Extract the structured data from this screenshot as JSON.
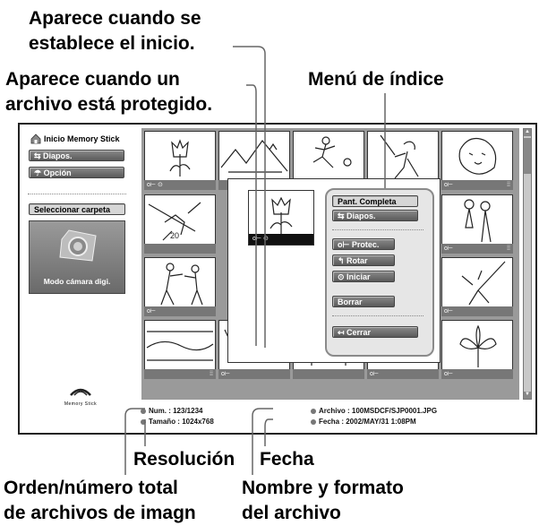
{
  "callouts": {
    "start_set": "Aparece cuando se",
    "start_set_2": "establece el inicio.",
    "protected": "Aparece cuando un",
    "protected_2": "archivo está protegido.",
    "index_menu": "Menú de índice",
    "resolution": "Resolución",
    "date": "Fecha",
    "order": "Orden/número total",
    "order_2": "de archivos de imagn",
    "filename": "Nombre y formato",
    "filename_2": "del archivo"
  },
  "sidebar": {
    "home": "Inicio Memory Stick",
    "slideshow": "Diapos.",
    "option": "Opción",
    "select_folder": "Seleccionar carpeta",
    "camera_mode": "Modo cámara digi.",
    "logo_text": "Memory Stick"
  },
  "popup_menu": {
    "full_screen": "Pant. Completa",
    "slideshow": "Diapos.",
    "protect": "Protec.",
    "rotate": "Rotar",
    "start": "Iniciar",
    "delete": "Borrar",
    "close": "Cerrar"
  },
  "status": {
    "num": "Num.     : 123/1234",
    "size": "Tamaño : 1024x768",
    "file": "Archivo : 100MSDCF/SJP0001.JPG",
    "date": "Fecha   : 2002/MAY/31 1:08PM"
  },
  "icons": {
    "key": "key-icon",
    "start_marker": "start-marker-icon",
    "grid": "index-grid-icon",
    "home": "home-icon"
  }
}
